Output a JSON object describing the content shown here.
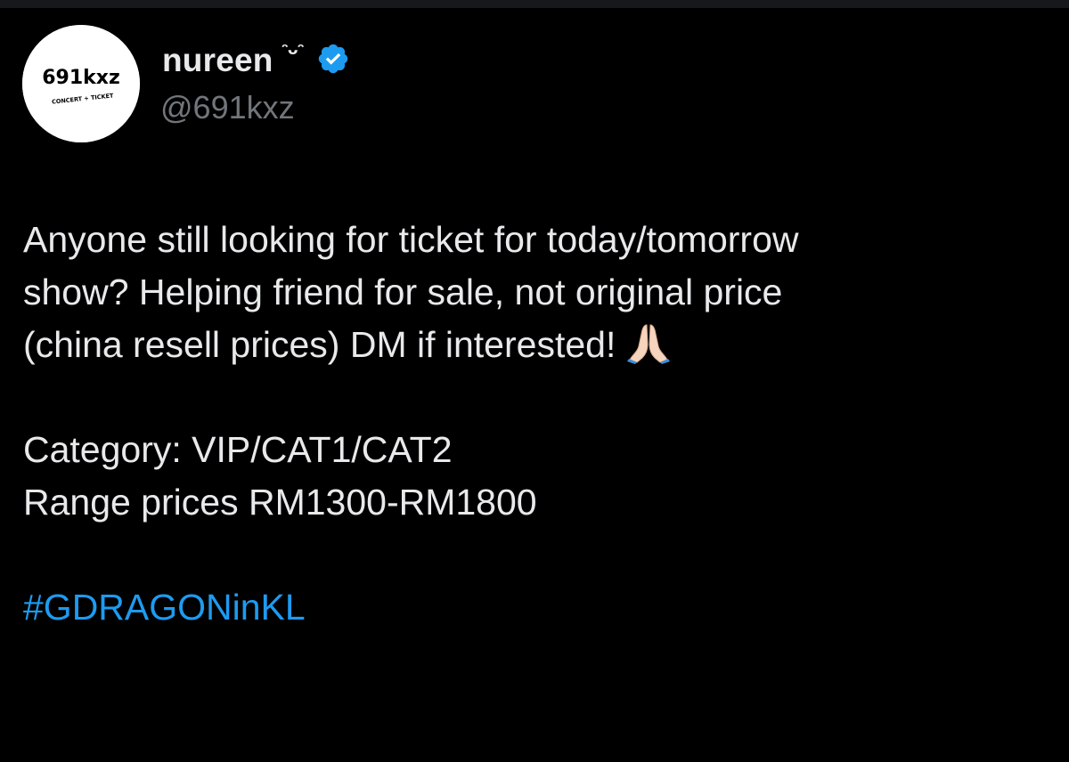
{
  "author": {
    "display_name": "nureen",
    "name_emoticon": "ᵔᴗᵔ",
    "handle": "@691kxz",
    "verified": true,
    "avatar": {
      "logo_text": "691kxz",
      "logo_subtext": "CONCERT + TICKET"
    }
  },
  "tweet": {
    "lines": [
      "Anyone still looking for ticket for today/tomorrow",
      "show? Helping friend for sale, not original price",
      "(china resell prices) DM if interested!"
    ],
    "emoji_icon": "folded-hands-icon",
    "category_line": "Category: VIP/CAT1/CAT2",
    "price_line": "Range prices RM1300-RM1800",
    "hashtag": "#GDRAGONinKL"
  },
  "colors": {
    "background": "#000000",
    "text_primary": "#e7e9ea",
    "text_secondary": "#71767b",
    "accent_link": "#1d9bf0",
    "verified_badge": "#1d9bf0"
  }
}
